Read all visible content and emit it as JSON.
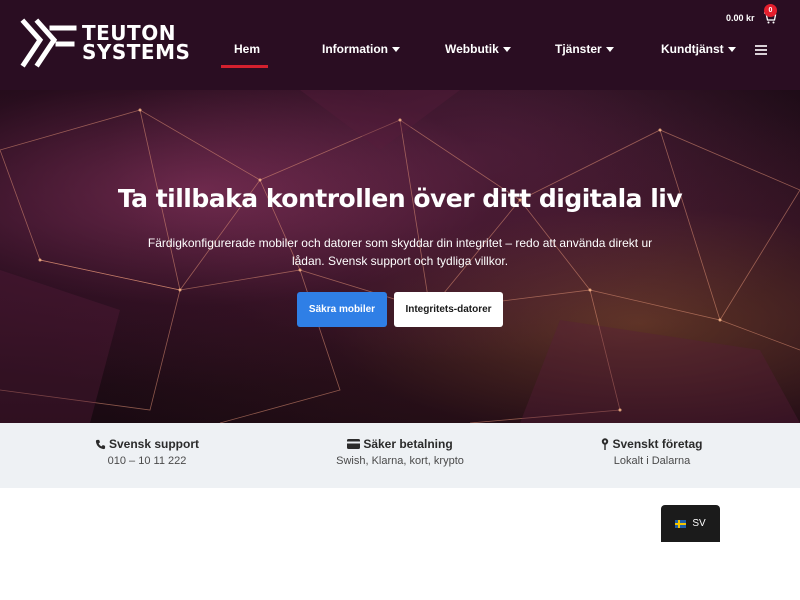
{
  "brand": {
    "name_line1": "TEUTON",
    "name_line2": "SYSTEMS"
  },
  "cart": {
    "amount": "0.00 kr",
    "count": "0"
  },
  "nav": {
    "items": [
      {
        "label": "Hem"
      },
      {
        "label": "Information"
      },
      {
        "label": "Webbutik"
      },
      {
        "label": "Tjänster"
      },
      {
        "label": "Kundtjänst"
      }
    ]
  },
  "hero": {
    "title": "Ta tillbaka kontrollen över ditt digitala liv",
    "subtitle": "Färdigkonfigurerade mobiler och datorer som skyddar din integritet – redo att använda direkt ur lådan. Svensk support och tydliga villkor.",
    "primary_button": "Säkra mobiler",
    "secondary_button": "Integritets-datorer"
  },
  "features": [
    {
      "icon": "phone-icon",
      "title": "Svensk support",
      "subtitle": "010 – 10 11 222"
    },
    {
      "icon": "credit-card-icon",
      "title": "Säker betalning",
      "subtitle": "Swish, Klarna, kort, krypto"
    },
    {
      "icon": "map-pin-icon",
      "title": "Svenskt företag",
      "subtitle": "Lokalt i Dalarna"
    }
  ],
  "language": {
    "code": "SV"
  },
  "colors": {
    "header_bg": "#2a0d22",
    "accent_red": "#d3202e",
    "primary_blue": "#2f7fe6",
    "features_bg": "#eef1f4"
  }
}
